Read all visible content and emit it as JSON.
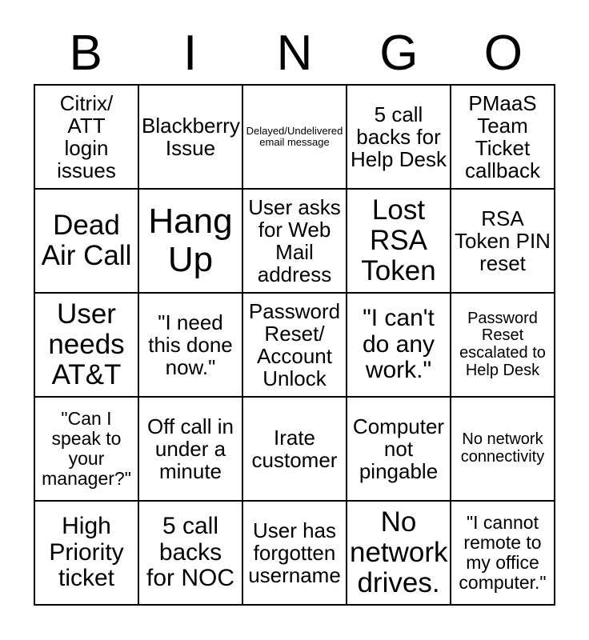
{
  "card": {
    "header_letters": [
      "B",
      "I",
      "N",
      "G",
      "O"
    ],
    "columns": 5,
    "rows": 5,
    "background_color": "#ffffff",
    "border_color": "#000000",
    "text_color": "#000000"
  },
  "squares": [
    {
      "row": 1,
      "column": 1,
      "letter": "B",
      "text": "Citrix/\nATT\nlogin\nissues",
      "size": "md"
    },
    {
      "row": 1,
      "column": 2,
      "letter": "I",
      "text": "Blackberry\nIssue",
      "size": "lg"
    },
    {
      "row": 1,
      "column": 3,
      "letter": "N",
      "text": "Delayed/Undelivered\nemail message",
      "size": "xxs"
    },
    {
      "row": 1,
      "column": 4,
      "letter": "G",
      "text": "5 call\nbacks for\nHelp Desk",
      "size": "md"
    },
    {
      "row": 1,
      "column": 5,
      "letter": "O",
      "text": "PMaaS\nTeam\nTicket\ncallback",
      "size": "md"
    },
    {
      "row": 2,
      "column": 1,
      "letter": "B",
      "text": "Dead\nAir Call",
      "size": "xl"
    },
    {
      "row": 2,
      "column": 2,
      "letter": "I",
      "text": "Hang\nUp",
      "size": "xxl"
    },
    {
      "row": 2,
      "column": 3,
      "letter": "N",
      "text": "User asks\nfor Web\nMail\naddress",
      "size": "md"
    },
    {
      "row": 2,
      "column": 4,
      "letter": "G",
      "text": "Lost\nRSA\nToken",
      "size": "xl"
    },
    {
      "row": 2,
      "column": 5,
      "letter": "O",
      "text": "RSA\nToken PIN\nreset",
      "size": "md"
    },
    {
      "row": 3,
      "column": 1,
      "letter": "B",
      "text": "User\nneeds\nAT&T",
      "size": "xl"
    },
    {
      "row": 3,
      "column": 2,
      "letter": "I",
      "text": "\"I need\nthis done\nnow.\"",
      "size": "md"
    },
    {
      "row": 3,
      "column": 3,
      "letter": "N",
      "text": "Password\nReset/\nAccount\nUnlock",
      "size": "md"
    },
    {
      "row": 3,
      "column": 4,
      "letter": "G",
      "text": "\"I can't\ndo any\nwork.\"",
      "size": "lg"
    },
    {
      "row": 3,
      "column": 5,
      "letter": "O",
      "text": "Password\nReset\nescalated to\nHelp Desk",
      "size": "xs"
    },
    {
      "row": 4,
      "column": 1,
      "letter": "B",
      "text": "\"Can I\nspeak to\nyour\nmanager?\"",
      "size": "sm"
    },
    {
      "row": 4,
      "column": 2,
      "letter": "I",
      "text": "Off call in\nunder a\nminute",
      "size": "md"
    },
    {
      "row": 4,
      "column": 3,
      "letter": "N",
      "text": "Irate\ncustomer",
      "size": "md"
    },
    {
      "row": 4,
      "column": 4,
      "letter": "G",
      "text": "Computer\nnot\npingable",
      "size": "md"
    },
    {
      "row": 4,
      "column": 5,
      "letter": "O",
      "text": "No network\nconnectivity",
      "size": "xs"
    },
    {
      "row": 5,
      "column": 1,
      "letter": "B",
      "text": "High\nPriority\nticket",
      "size": "lg"
    },
    {
      "row": 5,
      "column": 2,
      "letter": "I",
      "text": "5 call\nbacks\nfor NOC",
      "size": "lg"
    },
    {
      "row": 5,
      "column": 3,
      "letter": "N",
      "text": "User has\nforgotten\nusername",
      "size": "md"
    },
    {
      "row": 5,
      "column": 4,
      "letter": "G",
      "text": "No\nnetwork\ndrives.",
      "size": "xl"
    },
    {
      "row": 5,
      "column": 5,
      "letter": "O",
      "text": "\"I cannot\nremote to\nmy office\ncomputer.\"",
      "size": "sm"
    }
  ]
}
